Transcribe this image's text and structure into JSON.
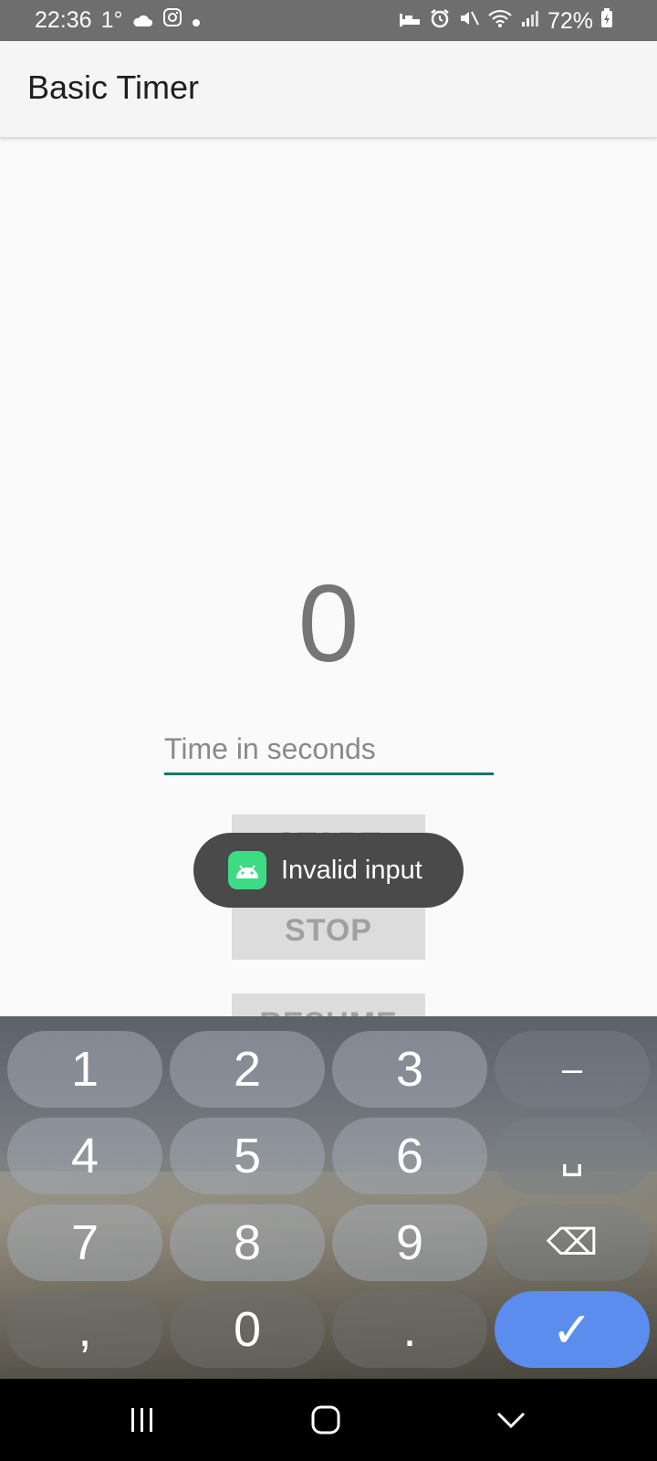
{
  "status_bar": {
    "time": "22:36",
    "temperature": "1°",
    "battery": "72%"
  },
  "app_bar": {
    "title": "Basic Timer"
  },
  "timer": {
    "value": "0",
    "input_placeholder": "Time in seconds",
    "input_value": ""
  },
  "buttons": {
    "start": "START",
    "stop": "STOP",
    "resume": "RESUME"
  },
  "toast": {
    "message": "Invalid input"
  },
  "keyboard": {
    "keys": [
      {
        "label": "1"
      },
      {
        "label": "2"
      },
      {
        "label": "3"
      },
      {
        "label": "–"
      },
      {
        "label": "4"
      },
      {
        "label": "5"
      },
      {
        "label": "6"
      },
      {
        "label": "␣"
      },
      {
        "label": "7"
      },
      {
        "label": "8"
      },
      {
        "label": "9"
      },
      {
        "label": "⌫"
      },
      {
        "label": ","
      },
      {
        "label": "0"
      },
      {
        "label": "."
      },
      {
        "label": "✓"
      }
    ]
  },
  "colors": {
    "accent": "#00796b",
    "enter_key": "#5b8def",
    "toast_bg": "#4a4a4a",
    "android_green": "#3ddc84"
  }
}
